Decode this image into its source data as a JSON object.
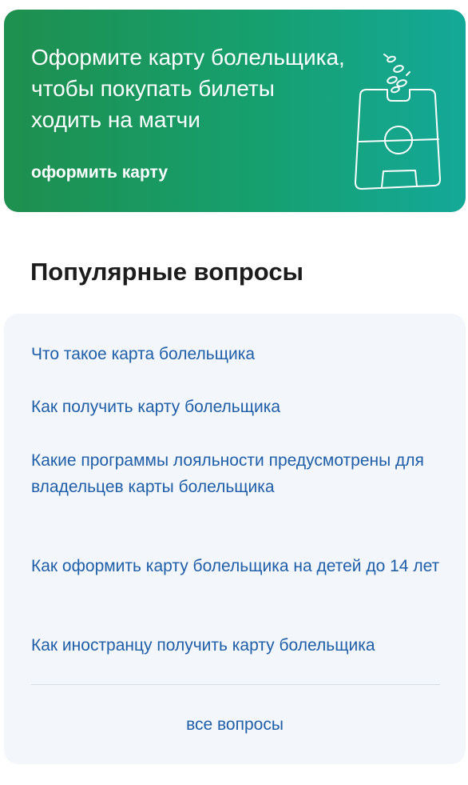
{
  "banner": {
    "title": "Оформите карту болельщика,\nчтобы покупать билеты\nходить на матчи",
    "link_label": "оформить карту",
    "illustration_icon": "football-field-ticket-icon",
    "background_colors": [
      "#1e8f4e",
      "#14a898"
    ]
  },
  "faq": {
    "title": "Популярные вопросы",
    "items": [
      {
        "label": "Что такое карта болельщика"
      },
      {
        "label": "Как получить карту болельщика"
      },
      {
        "label": "Какие программы лояльности предусмотрены для владельцев карты болельщика"
      },
      {
        "label": "Как оформить карту болельщика на детей до 14 лет"
      },
      {
        "label": "Как иностранцу получить карту болельщика"
      }
    ],
    "all_label": "все вопросы",
    "link_color": "#1f5ea8"
  }
}
